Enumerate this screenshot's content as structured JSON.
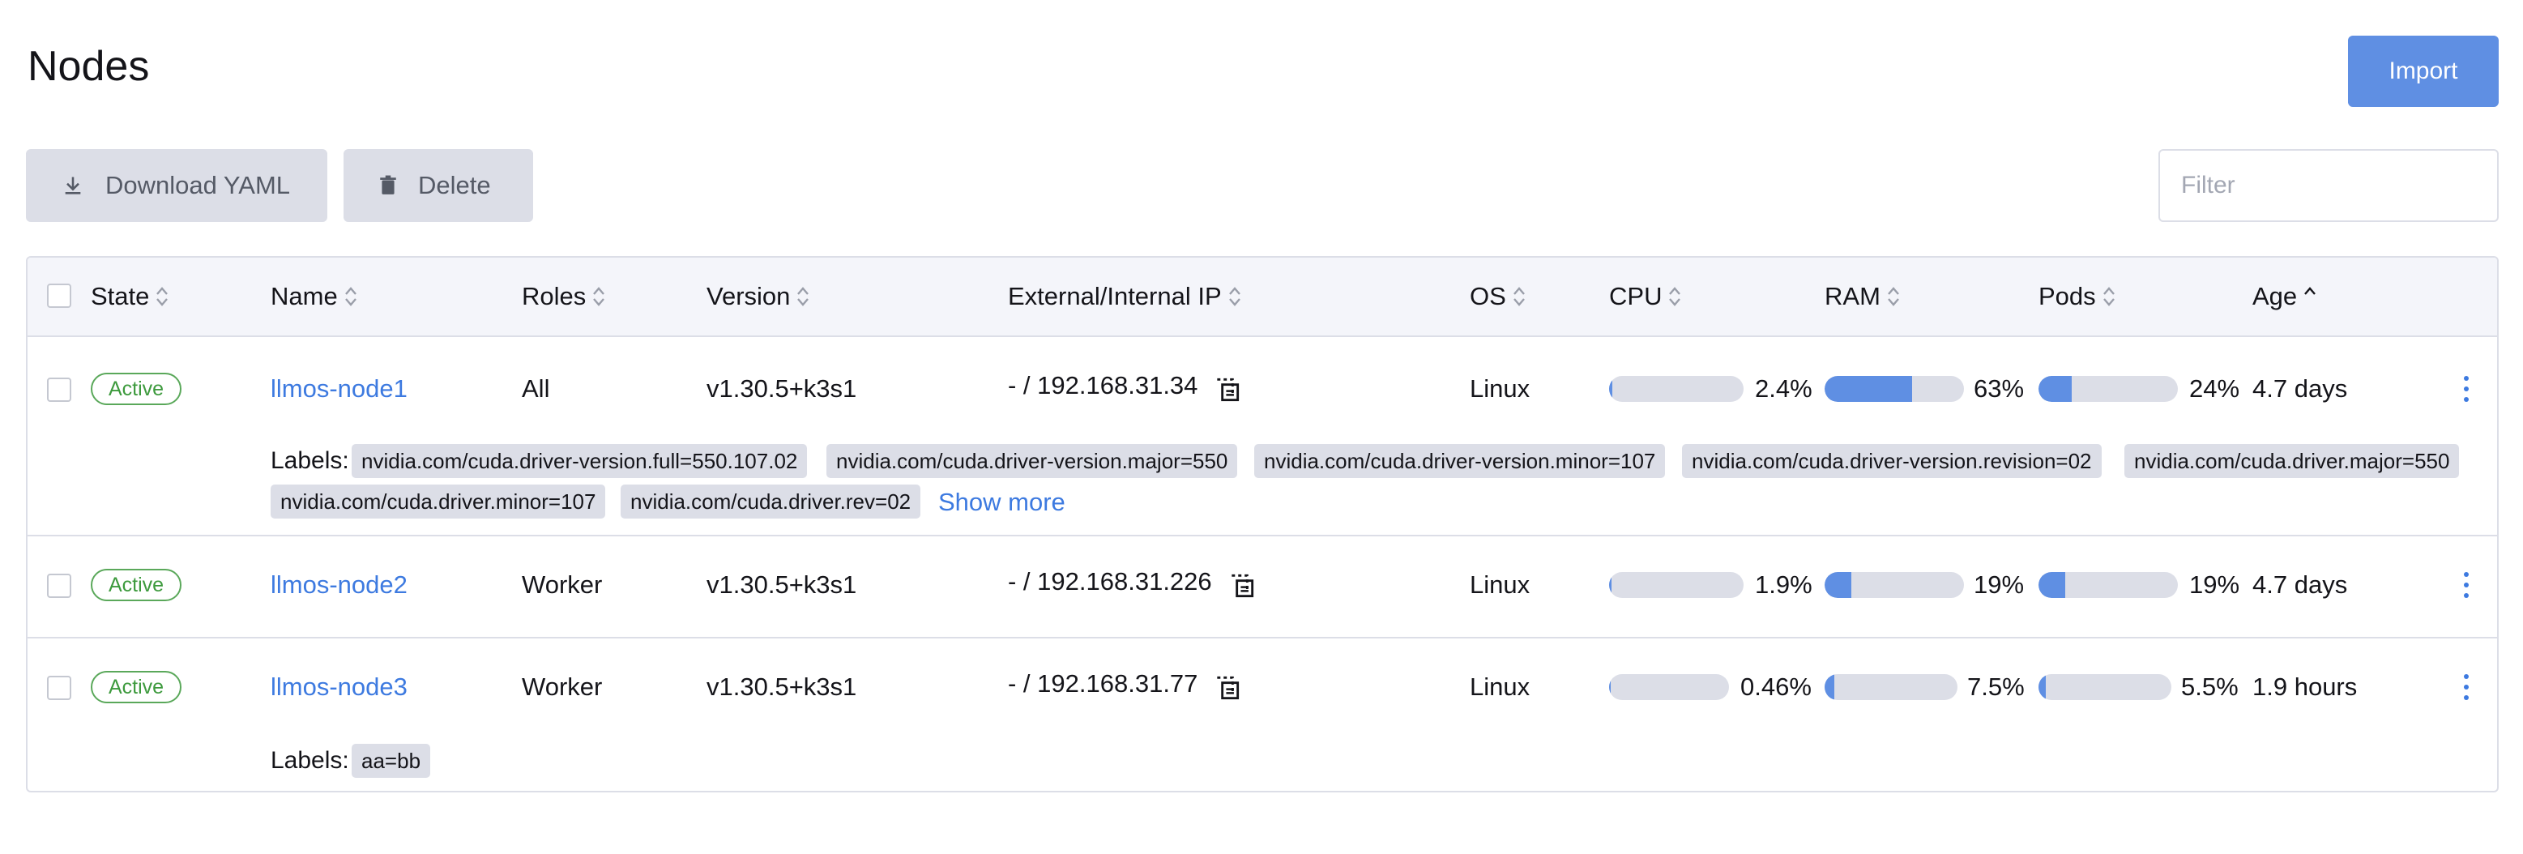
{
  "page": {
    "title": "Nodes"
  },
  "actions": {
    "import_label": "Import",
    "download_label": "Download YAML",
    "delete_label": "Delete",
    "filter_placeholder": "Filter"
  },
  "table": {
    "columns": [
      "State",
      "Name",
      "Roles",
      "Version",
      "External/Internal IP",
      "OS",
      "CPU",
      "RAM",
      "Pods",
      "Age"
    ],
    "sorted_column": "Age",
    "labels_title": "Labels:",
    "show_more": "Show more",
    "rows": [
      {
        "state": "Active",
        "name": "llmos-node1",
        "roles": "All",
        "version": "v1.30.5+k3s1",
        "ip": "- / 192.168.31.34",
        "os": "Linux",
        "cpu": {
          "label": "2.4%",
          "fraction": 0.024
        },
        "ram": {
          "label": "63%",
          "fraction": 0.63
        },
        "pods": {
          "label": "24%",
          "fraction": 0.24
        },
        "age": "4.7 days",
        "labels": [
          "nvidia.com/cuda.driver-version.full=550.107.02",
          "nvidia.com/cuda.driver-version.major=550",
          "nvidia.com/cuda.driver-version.minor=107",
          "nvidia.com/cuda.driver-version.revision=02",
          "nvidia.com/cuda.driver.major=550",
          "nvidia.com/cuda.driver.minor=107",
          "nvidia.com/cuda.driver.rev=02"
        ]
      },
      {
        "state": "Active",
        "name": "llmos-node2",
        "roles": "Worker",
        "version": "v1.30.5+k3s1",
        "ip": "- / 192.168.31.226",
        "os": "Linux",
        "cpu": {
          "label": "1.9%",
          "fraction": 0.019
        },
        "ram": {
          "label": "19%",
          "fraction": 0.19
        },
        "pods": {
          "label": "19%",
          "fraction": 0.19
        },
        "age": "4.7 days",
        "labels": []
      },
      {
        "state": "Active",
        "name": "llmos-node3",
        "roles": "Worker",
        "version": "v1.30.5+k3s1",
        "ip": "- / 192.168.31.77",
        "os": "Linux",
        "cpu": {
          "label": "0.46%",
          "fraction": 0.0046
        },
        "ram": {
          "label": "7.5%",
          "fraction": 0.075
        },
        "pods": {
          "label": "5.5%",
          "fraction": 0.055
        },
        "age": "1.9 hours",
        "labels": [
          "aa=bb"
        ]
      }
    ]
  },
  "colors": {
    "accent": "#5f8fe3",
    "link": "#3d7ae0",
    "active": "#3d9a3d",
    "chip_bg": "#dcdee7"
  }
}
